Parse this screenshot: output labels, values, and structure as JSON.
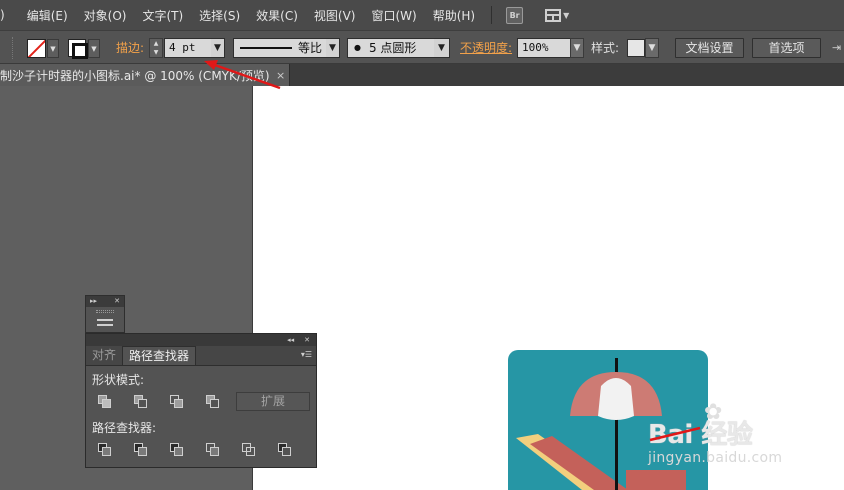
{
  "menubar": {
    "items": [
      "编辑(E)",
      "对象(O)",
      "文字(T)",
      "选择(S)",
      "效果(C)",
      "视图(V)",
      "窗口(W)",
      "帮助(H)"
    ],
    "leading_fragment": ")",
    "bridge_label": "Br"
  },
  "controlbar": {
    "fill_swatch": "none",
    "stroke_label": "描边:",
    "stroke_weight": "4 pt",
    "profile_label": "等比",
    "brush_label": "5 点圆形",
    "brush_dot": "●",
    "opacity_label": "不透明度:",
    "opacity_value": "100%",
    "style_label": "样式:",
    "doc_setup_button": "文档设置",
    "prefs_button": "首选项",
    "colors": {
      "label_orange": "#f2a14a",
      "none_slash": "#e2231a"
    }
  },
  "document_tab": {
    "title": "制沙子计时器的小图标.ai* @ 100% (CMYK/预览)",
    "close": "×"
  },
  "pathfinder_panel": {
    "tabs": [
      {
        "label": "对齐",
        "active": false
      },
      {
        "label": "路径查找器",
        "active": true
      }
    ],
    "shape_modes_label": "形状模式:",
    "expand_button": "扩展",
    "pathfinders_label": "路径查找器:",
    "shape_mode_icons": [
      "unite-icon",
      "minus-front-icon",
      "intersect-icon",
      "exclude-icon"
    ],
    "pathfinder_icons": [
      "divide-icon",
      "trim-icon",
      "merge-icon",
      "crop-icon",
      "outline-icon",
      "minus-back-icon"
    ]
  },
  "watermark": {
    "logo": "Bai 经验",
    "site": "jingyan.baidu.com"
  },
  "artwork": {
    "background": "#2696a5",
    "umbrella": "#cd7b74",
    "lamp": "#f2f2f2",
    "chair": "#c4615a",
    "chair_accent": "#f2cf7e"
  }
}
